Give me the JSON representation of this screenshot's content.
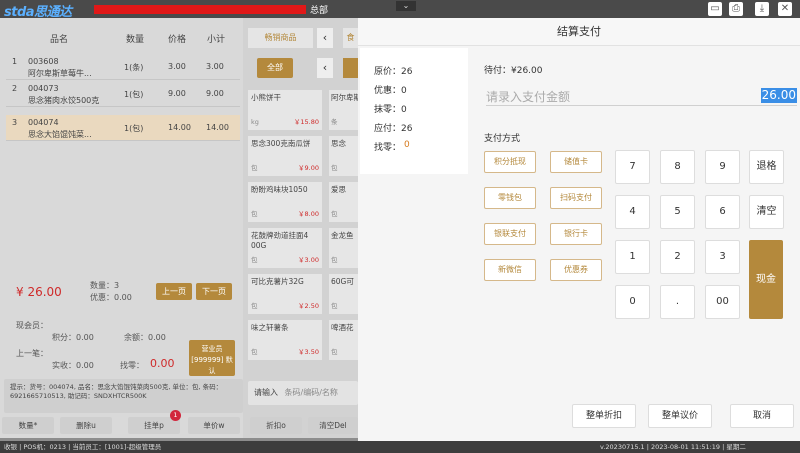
{
  "topbar": {
    "logo": "stda思通达",
    "shop_suffix": "总部",
    "chevron": "⌄",
    "icons": [
      "window-icon",
      "printer-icon",
      "minimize-icon",
      "close-icon"
    ]
  },
  "cart": {
    "headers": [
      "品名",
      "数量",
      "价格",
      "小计"
    ],
    "rows": [
      {
        "index": "1",
        "code": "003608",
        "name": "阿尔卑斯草莓牛...",
        "qty": "1(条)",
        "price": "3.00",
        "subtotal": "3.00"
      },
      {
        "index": "2",
        "code": "004073",
        "name": "思念猪肉水饺500克",
        "qty": "1(包)",
        "price": "9.00",
        "subtotal": "9.00"
      },
      {
        "index": "3",
        "code": "004074",
        "name": "思念大馅馄饨菜...",
        "qty": "1(包)",
        "price": "14.00",
        "subtotal": "14.00"
      }
    ],
    "total": "¥ 26.00",
    "qty_label": "数量：3",
    "discount_label": "优惠：0.00",
    "prev_page": "上一页",
    "next_page": "下一页"
  },
  "member": {
    "member_label": "现会员：",
    "points_label": "积分：0.00",
    "balance_label": "余额：0.00",
    "last_label": "上一笔：",
    "paid_label": "实收：0.00",
    "change_label": "找零：",
    "change_value": "0.00",
    "cashier_line1": "营业员",
    "cashier_line2": "[999999] 默认"
  },
  "hint": {
    "line1": "提示：货号：004074, 品名：思念大馅馄饨菜肉500克, 单位：包, 条码：6921665710513, 助记码：SNDXHTCR500K"
  },
  "grid": {
    "tab_hot": "畅销商品",
    "tab_other": "食",
    "arrow_left": "‹",
    "category_all": "全部",
    "products": [
      {
        "name": "小熊饼干",
        "unit": "kg",
        "price": "￥15.80"
      },
      {
        "name": "思念300克南瓜饼",
        "unit": "包",
        "price": "￥9.00"
      },
      {
        "name": "盼盼鸡味块1050",
        "unit": "包",
        "price": "￥8.00"
      },
      {
        "name": "花鼓牌劲道挂面4 00G",
        "unit": "包",
        "price": "￥3.00"
      },
      {
        "name": "可比克薯片32G",
        "unit": "包",
        "price": "￥2.50"
      },
      {
        "name": "味之轩薯条",
        "unit": "包",
        "price": "￥3.50"
      }
    ],
    "products_right": [
      {
        "name": "阿尔卑斯奶糖",
        "unit": "条"
      },
      {
        "name": "思念",
        "unit": "包"
      },
      {
        "name": "爱思",
        "unit": "包"
      },
      {
        "name": "金龙鱼",
        "unit": "包"
      },
      {
        "name": "60G可",
        "unit": "包"
      },
      {
        "name": "啤酒花",
        "unit": "包"
      }
    ],
    "search_label": "请输入",
    "search_placeholder": "条码/编码/名称"
  },
  "footer": {
    "buttons": [
      "数量*",
      "删除u",
      "挂单p",
      "单价w",
      "折扣o",
      "清空Del"
    ],
    "badge": "1",
    "status_left": "收银 | POS机：0213 | 当前员工：[1001]-超级管理员",
    "status_right": "v.20230715.1 | 2023-08-01 11:51:19 | 星期二"
  },
  "payment": {
    "title": "结算支付",
    "summary": {
      "original": "原价：26",
      "discount": "优惠：0",
      "rounding": "抹零：0",
      "payable": "应付：26",
      "change_label": "找零：",
      "change_value": "0"
    },
    "due": "待付：¥26.00",
    "input_placeholder": "请录入支付金额",
    "input_value": "26.00",
    "method_title": "支付方式",
    "methods": [
      "积分抵现",
      "储值卡",
      "零钱包",
      "扫码支付",
      "银联支付",
      "银行卡",
      "新微信",
      "优惠券"
    ],
    "keypad": [
      "7",
      "8",
      "9",
      "4",
      "5",
      "6",
      "1",
      "2",
      "3",
      "0",
      ".",
      "00"
    ],
    "key_backspace": "退格",
    "key_clear": "清空",
    "key_cash": "现金",
    "btn_discount": "整单折扣",
    "btn_bargain": "整单议价",
    "btn_cancel": "取消"
  }
}
